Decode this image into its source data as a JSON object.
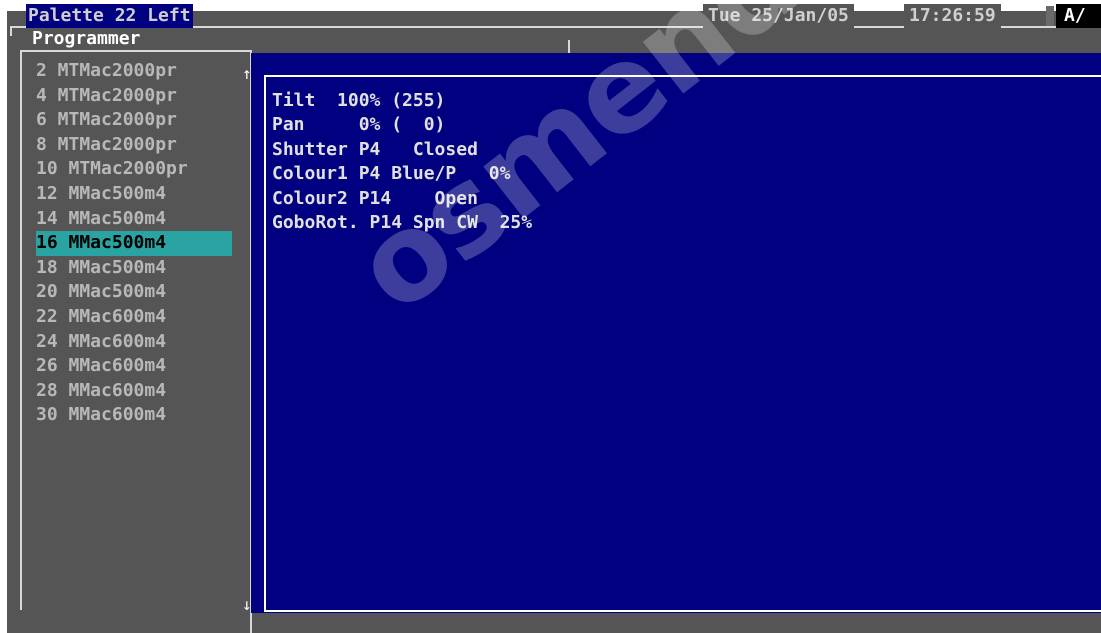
{
  "window": {
    "title": "Palette 22 Left",
    "date": "Tue 25/Jan/05",
    "time": "17:26:59",
    "status_letter": "A/"
  },
  "programmer": {
    "label": "Programmer",
    "selected_index": 7,
    "fixtures": [
      "2 MTMac2000pr",
      "4 MTMac2000pr",
      "6 MTMac2000pr",
      "8 MTMac2000pr",
      "10 MTMac2000pr",
      "12 MMac500m4",
      "14 MMac500m4",
      "16 MMac500m4",
      "18 MMac500m4",
      "20 MMac500m4",
      "22 MMac600m4",
      "24 MMac600m4",
      "26 MMac600m4",
      "28 MMac600m4",
      "30 MMac600m4"
    ],
    "scroll_up_icon": "arrow-up-icon",
    "scroll_down_icon": "arrow-down-icon"
  },
  "attributes": [
    "Tilt  100% (255)",
    "Pan     0% (  0)",
    "Shutter P4   Closed",
    "Colour1 P4 Blue/P   0%",
    "Colour2 P14    Open",
    "GoboRot. P14 Spn CW  25%"
  ],
  "watermark": "osmendoza.co",
  "colors": {
    "panel_bg": "#000080",
    "screen_bg": "#555555",
    "selection": "#2aa3a3"
  }
}
